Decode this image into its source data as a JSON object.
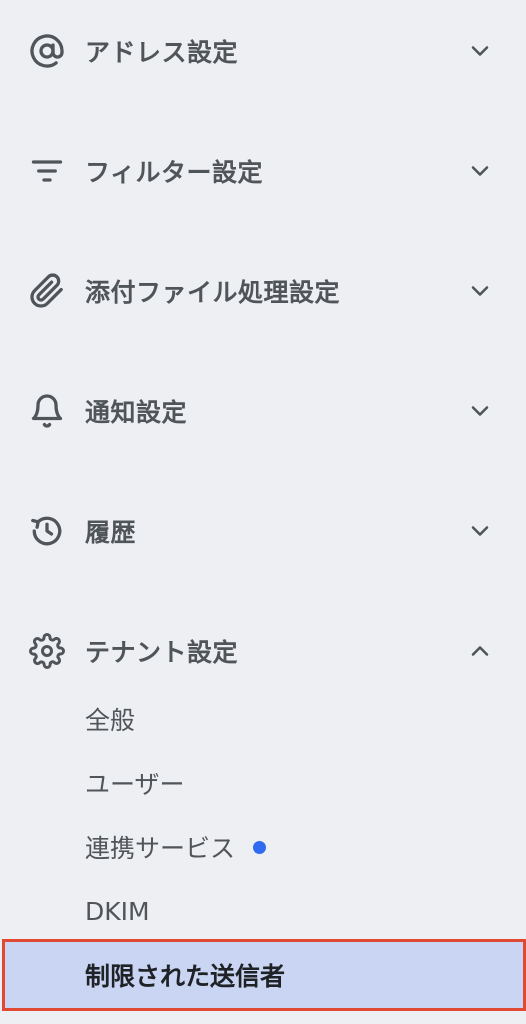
{
  "menu": {
    "sections": [
      {
        "label": "アドレス設定",
        "icon": "at-sign-icon",
        "expanded": false
      },
      {
        "label": "フィルター設定",
        "icon": "filter-icon",
        "expanded": false
      },
      {
        "label": "添付ファイル処理設定",
        "icon": "paperclip-icon",
        "expanded": false
      },
      {
        "label": "通知設定",
        "icon": "bell-icon",
        "expanded": false
      },
      {
        "label": "履歴",
        "icon": "history-icon",
        "expanded": false
      },
      {
        "label": "テナント設定",
        "icon": "gear-icon",
        "expanded": true
      }
    ],
    "tenant_items": [
      {
        "label": "全般"
      },
      {
        "label": "ユーザー"
      },
      {
        "label": "連携サービス",
        "badge": "notification-dot",
        "badge_color": "#2f6bf0"
      },
      {
        "label": "DKIM"
      },
      {
        "label": "制限された送信者",
        "selected": true
      }
    ]
  },
  "colors": {
    "background": "#eeeff2",
    "text": "#505559",
    "selected_background": "#c9d5f2",
    "selected_border": "#e04a32",
    "selected_text": "#1f2226",
    "badge": "#2f6bf0"
  }
}
